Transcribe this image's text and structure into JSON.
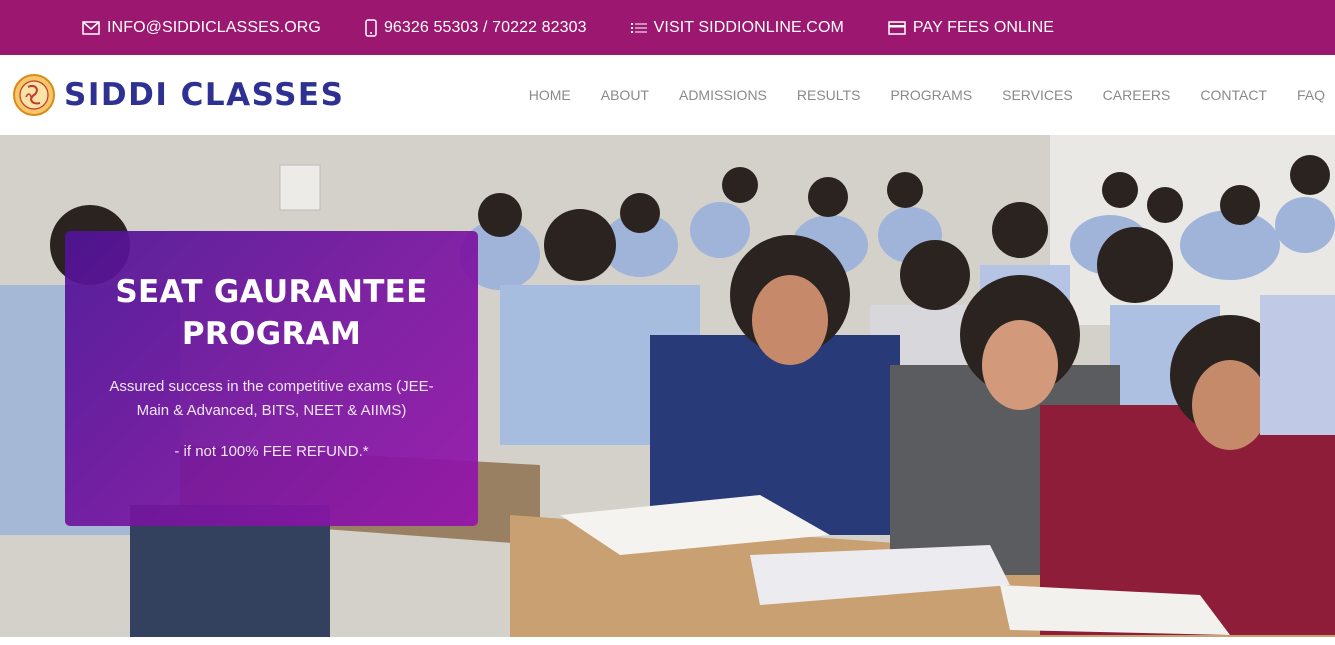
{
  "topbar": {
    "email": "INFO@SIDDICLASSES.ORG",
    "phone": "96326 55303 / 70222 82303",
    "website": "VISIT SIDDIONLINE.COM",
    "fees": "PAY FEES ONLINE",
    "icons": [
      "envelope-icon",
      "phone-icon",
      "list-icon",
      "card-icon"
    ]
  },
  "brand": {
    "name": "SIDDI CLASSES",
    "color": "#2e3192"
  },
  "menu": [
    {
      "label": "HOME"
    },
    {
      "label": "ABOUT"
    },
    {
      "label": "ADMISSIONS"
    },
    {
      "label": "RESULTS"
    },
    {
      "label": "PROGRAMS"
    },
    {
      "label": "SERVICES"
    },
    {
      "label": "CAREERS"
    },
    {
      "label": "CONTACT"
    },
    {
      "label": "FAQ"
    }
  ],
  "hero": {
    "title_line1": "SEAT GAURANTEE",
    "title_line2": "PROGRAM",
    "description": "Assured success in the competitive exams (JEE-Main & Advanced, BITS, NEET & AIIMS)",
    "refund": "- if not 100% FEE REFUND.*"
  },
  "colors": {
    "topbar": "#9c1870",
    "menu_text": "#8a8a8a",
    "card": "#7a1aa0"
  }
}
